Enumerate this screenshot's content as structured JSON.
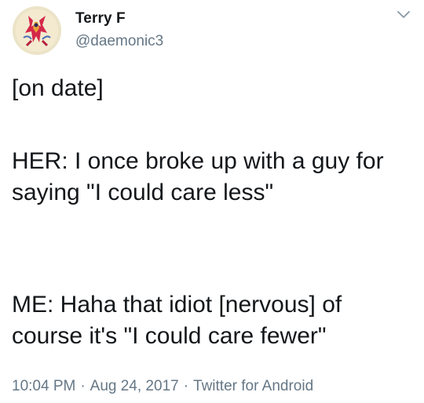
{
  "user": {
    "display_name": "Terry F",
    "handle": "@daemonic3",
    "avatar": "avatar-icon"
  },
  "menu": {
    "icon": "chevron-down-icon"
  },
  "tweet": {
    "line1": "[on date]",
    "para2": "HER: I once broke up with a guy for saying \"I could care less\"",
    "para3": "ME: Haha that idiot [nervous] of course it's \"I could care fewer\""
  },
  "meta": {
    "time": "10:04 PM",
    "separator": "·",
    "date": "Aug 24, 2017",
    "source": "Twitter for Android"
  },
  "colors": {
    "text": "#14171a",
    "secondary": "#657786",
    "background": "#ffffff"
  }
}
